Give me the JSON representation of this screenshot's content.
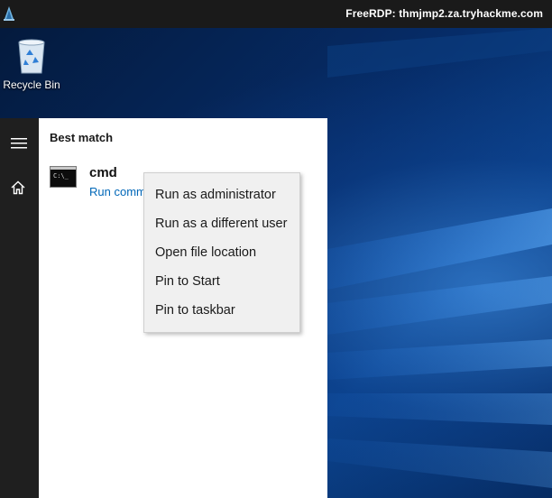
{
  "window": {
    "title": "FreeRDP: thmjmp2.za.tryhackme.com"
  },
  "desktop": {
    "icons": [
      {
        "label": "Recycle Bin",
        "icon": "recycle-bin-icon"
      }
    ]
  },
  "start_menu": {
    "rail": [
      {
        "icon": "hamburger-menu-icon"
      },
      {
        "icon": "home-icon"
      }
    ],
    "section_title": "Best match",
    "best_match": {
      "name": "cmd",
      "subtitle": "Run comm",
      "icon": "command-prompt-icon",
      "icon_text": "C:\\_"
    }
  },
  "context_menu": {
    "items": [
      "Run as administrator",
      "Run as a different user",
      "Open file location",
      "Pin to Start",
      "Pin to taskbar"
    ]
  },
  "colors": {
    "titlebar": "#1a1a1a",
    "rail": "#1f1f1f",
    "link": "#0067b8",
    "menu_bg": "#f0f0f0"
  }
}
